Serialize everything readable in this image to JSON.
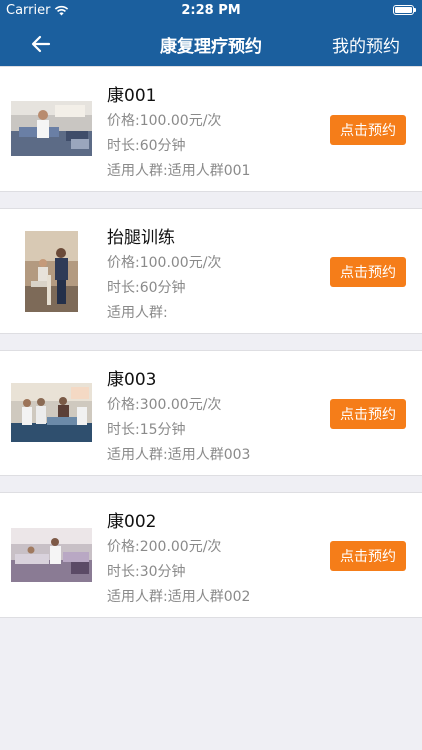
{
  "status_bar": {
    "carrier": "Carrier",
    "time": "2:28 PM"
  },
  "nav": {
    "title": "康复理疗预约",
    "right_link": "我的预约"
  },
  "colors": {
    "header": "#1b5f9e",
    "accent": "#f57d19",
    "background": "#efeff4"
  },
  "items": [
    {
      "name": "康001",
      "price": "价格:100.00元/次",
      "duration": "时长:60分钟",
      "audience": "适用人群:适用人群001",
      "button": "点击预约"
    },
    {
      "name": "抬腿训练",
      "price": "价格:100.00元/次",
      "duration": "时长:60分钟",
      "audience": "适用人群:",
      "button": "点击预约"
    },
    {
      "name": "康003",
      "price": "价格:300.00元/次",
      "duration": "时长:15分钟",
      "audience": "适用人群:适用人群003",
      "button": "点击预约"
    },
    {
      "name": "康002",
      "price": "价格:200.00元/次",
      "duration": "时长:30分钟",
      "audience": "适用人群:适用人群002",
      "button": "点击预约"
    }
  ]
}
